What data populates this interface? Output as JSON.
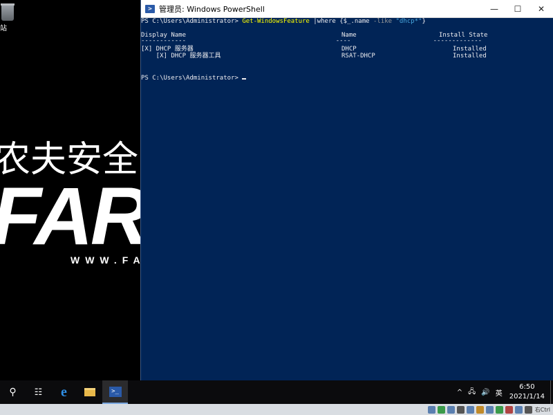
{
  "desktop": {
    "recycle_bin_label": "站",
    "wallpaper": {
      "chinese_text": "农夫安全",
      "brand_text": "FARM",
      "url_text": "WWW.FA"
    }
  },
  "window": {
    "title": "管理员: Windows PowerShell",
    "controls": {
      "minimize": "—",
      "maximize": "☐",
      "close": "✕"
    }
  },
  "console": {
    "prompt1": "PS C:\\Users\\Administrator> ",
    "command_name": "Get-WindowsFeature",
    "command_pipe": " |where {$_.name ",
    "command_op": "-like",
    "command_string": " \"dhcp*\"",
    "command_end": "}",
    "headers": {
      "display_name": "Display Name",
      "name": "Name",
      "install_state": "Install State"
    },
    "rows": [
      {
        "display_name": "[X] DHCP 服务器",
        "name": "DHCP",
        "install_state": "Installed"
      },
      {
        "display_name": "    [X] DHCP 服务器工具",
        "name": "RSAT-DHCP",
        "install_state": "Installed"
      }
    ],
    "prompt2": "PS C:\\Users\\Administrator> "
  },
  "taskbar": {
    "search_icon": "⚲",
    "task_view_icon": "☷",
    "edge_icon": "e",
    "explorer_icon": "📁",
    "powershell_icon": ">_",
    "tray": {
      "chevron": "^",
      "network_icon": "🖧",
      "volume_icon": "🔊",
      "ime_mode": "英"
    },
    "clock": {
      "time": "6:50",
      "date": "2021/1/14"
    }
  },
  "host_bar": {
    "text": "右Ctrl"
  },
  "colors": {
    "console_bg": "#012456",
    "console_fg": "#eeedf0",
    "command_yellow": "#ffff00",
    "string_blue": "#48a8e0"
  }
}
